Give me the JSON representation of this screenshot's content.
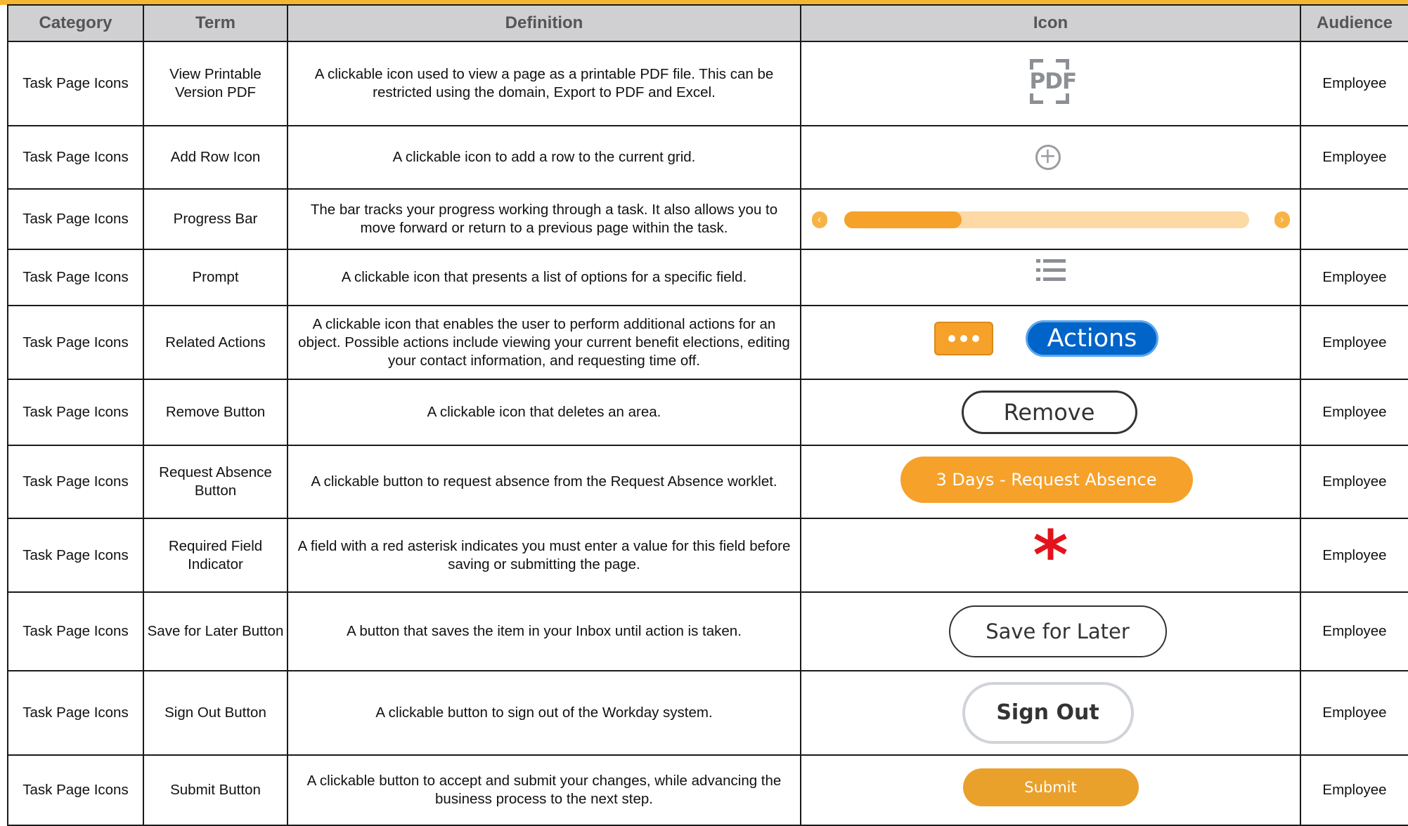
{
  "header": {
    "category": "Category",
    "term": "Term",
    "definition": "Definition",
    "icon": "Icon",
    "audience": "Audience"
  },
  "rows": [
    {
      "category": "Task Page Icons",
      "term": "View Printable Version PDF",
      "definition": "A clickable icon used to view a page as a printable PDF file. This can be restricted using the domain, Export to PDF and Excel.",
      "icon": "pdf-icon",
      "icon_text": "PDF",
      "audience": "Employee"
    },
    {
      "category": "Task Page Icons",
      "term": "Add Row Icon",
      "definition": "A clickable icon to add a row to the current grid.",
      "icon": "plus-circle-icon",
      "audience": "Employee"
    },
    {
      "category": "Task Page Icons",
      "term": "Progress Bar",
      "definition": "The bar tracks your progress working through a task. It also allows you to move forward or return to a previous page within the task.",
      "icon": "progress-bar",
      "progress_fraction": 0.29,
      "audience": ""
    },
    {
      "category": "Task Page Icons",
      "term": "Prompt",
      "definition": "A clickable icon that presents a list of options for a specific field.",
      "icon": "list-icon",
      "audience": "Employee"
    },
    {
      "category": "Task Page Icons",
      "term": "Related Actions",
      "definition": "A clickable icon that enables the user to perform additional actions for an object. Possible actions include viewing your current benefit elections, editing your contact information, and requesting time off.",
      "icon": "related-actions",
      "icon_text": "Actions",
      "audience": "Employee"
    },
    {
      "category": "Task Page Icons",
      "term": "Remove Button",
      "definition": "A clickable icon that deletes an area.",
      "icon": "remove-button",
      "icon_text": "Remove",
      "audience": "Employee"
    },
    {
      "category": "Task Page Icons",
      "term": "Request Absence Button",
      "definition": "A clickable button to request absence from the Request Absence worklet.",
      "icon": "request-absence-button",
      "icon_text": "3 Days - Request Absence",
      "audience": "Employee"
    },
    {
      "category": "Task Page Icons",
      "term": "Required Field Indicator",
      "definition": "A field with a red asterisk indicates you must enter a value for this field before saving or submitting the page.",
      "icon": "asterisk-icon",
      "icon_text": "*",
      "audience": "Employee"
    },
    {
      "category": "Task Page Icons",
      "term": "Save for Later Button",
      "definition": "A button that saves the item in your Inbox until action is taken.",
      "icon": "save-for-later-button",
      "icon_text": "Save for Later",
      "audience": "Employee"
    },
    {
      "category": "Task Page Icons",
      "term": "Sign Out Button",
      "definition": "A clickable button to sign out of the Workday system.",
      "icon": "sign-out-button",
      "icon_text": "Sign Out",
      "audience": "Employee"
    },
    {
      "category": "Task Page Icons",
      "term": "Submit Button",
      "definition": "A clickable button to accept and submit your changes, while advancing the business process to the next step.",
      "icon": "submit-button",
      "icon_text": "Submit",
      "audience": "Employee"
    }
  ],
  "colors": {
    "header_bg": "#d0cfd1",
    "top_accent": "#f5b731",
    "orange": "#f6a12a",
    "actions_blue": "#0064c8",
    "asterisk_red": "#e3131b"
  }
}
